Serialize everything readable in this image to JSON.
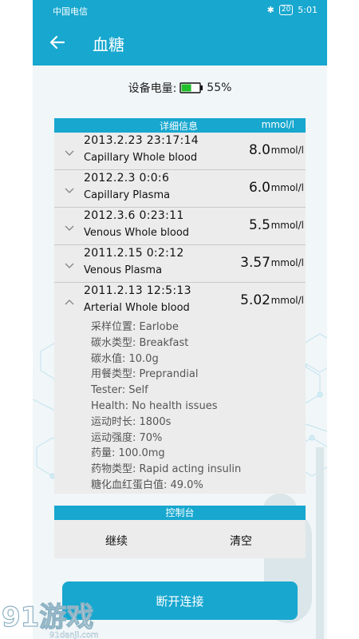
{
  "status_bar": {
    "carrier": "中国电信",
    "net_badges": "HD 4G",
    "battery_pct": "20",
    "time": "5:01"
  },
  "app_bar": {
    "title": "血糖",
    "back_icon": "arrow-left-icon"
  },
  "device": {
    "label": "设备电量:",
    "battery_level": "55%",
    "battery_icon": "battery-icon",
    "battery_fill_fraction": 0.55,
    "battery_color": "#22c02a"
  },
  "detail_card": {
    "header_title": "详细信息",
    "header_unit": "mmol/l",
    "records": [
      {
        "time": "2013.2.23  23:17:14",
        "type": "Capillary Whole blood",
        "value": "8.0",
        "unit": "mmol/l",
        "expanded": false
      },
      {
        "time": "2012.2.3  0:0:6",
        "type": "Capillary Plasma",
        "value": "6.0",
        "unit": "mmol/l",
        "expanded": false
      },
      {
        "time": "2012.3.6  0:23:11",
        "type": "Venous Whole blood",
        "value": "5.5",
        "unit": "mmol/l",
        "expanded": false
      },
      {
        "time": "2011.2.15  0:2:12",
        "type": "Venous Plasma",
        "value": "3.57",
        "unit": "mmol/l",
        "expanded": false
      },
      {
        "time": "2011.2.13  12:5:13",
        "type": "Arterial Whole blood",
        "value": "5.02",
        "unit": "mmol/l",
        "expanded": true
      }
    ],
    "details": [
      "采样位置: Earlobe",
      "碳水类型: Breakfast",
      "碳水值: 10.0g",
      "用餐类型: Preprandial",
      "Tester: Self",
      "Health: No health issues",
      "运动时长: 1800s",
      "运动强度: 70%",
      "药量: 100.0mg",
      "药物类型: Rapid acting insulin",
      "糖化血红蛋白值: 49.0%"
    ]
  },
  "console": {
    "title": "控制台",
    "continue_label": "继续",
    "clear_label": "清空"
  },
  "disconnect_label": "断开连接",
  "watermark": {
    "text": "91游戏",
    "url_text": "91danji.com"
  },
  "colors": {
    "accent": "#17a7cf",
    "card_bg": "#ececec",
    "page_bg": "#f1f6f8"
  }
}
